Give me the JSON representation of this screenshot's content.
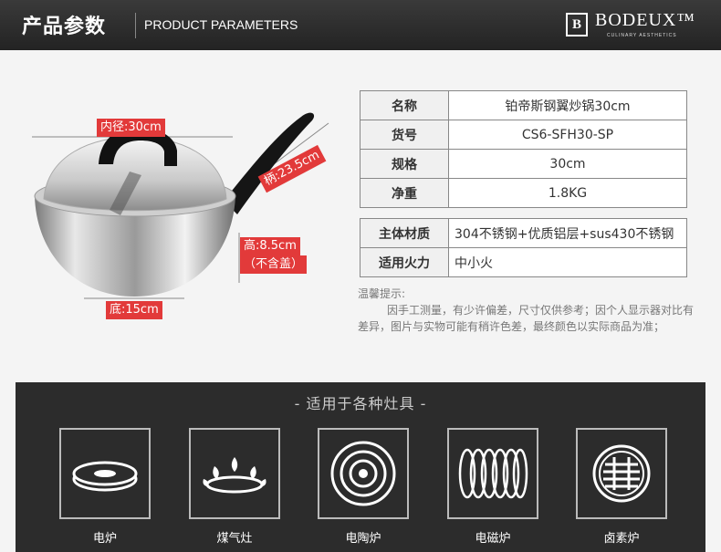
{
  "header": {
    "title_cn": "产品参数",
    "title_en": "PRODUCT PARAMETERS",
    "brand": "BODEUX™",
    "brand_sub": "CULINARY AESTHETICS",
    "logo_mark": "B"
  },
  "product": {
    "image_icon": "wok-with-glass-lid",
    "dimensions": {
      "inner_diameter": "内径:30cm",
      "handle": "柄:23.5cm",
      "height": "高:8.5cm",
      "height_note": "（不含盖）",
      "base": "底:15cm"
    }
  },
  "specs": [
    {
      "key": "名称",
      "value": "铂帝斯钢翼炒锅30cm"
    },
    {
      "key": "货号",
      "value": "CS6-SFH30-SP"
    },
    {
      "key": "规格",
      "value": "30cm"
    },
    {
      "key": "净重",
      "value": "1.8KG"
    }
  ],
  "specs2": [
    {
      "key": "主体材质",
      "value": "304不锈钢+优质铝层+sus430不锈钢"
    },
    {
      "key": "适用火力",
      "value": "中小火"
    }
  ],
  "tips": {
    "title": "温馨提示:",
    "body": "因手工测量，有少许偏差，尺寸仅供参考；因个人显示器对比有差异，图片与实物可能有稍许色差，最终颜色以实际商品为准；"
  },
  "stoves": {
    "title": "- 适用于各种灶具 -",
    "items": [
      {
        "label": "电炉",
        "icon": "electric-hotplate-icon"
      },
      {
        "label": "煤气灶",
        "icon": "gas-burner-icon"
      },
      {
        "label": "电陶炉",
        "icon": "ceramic-cooktop-icon"
      },
      {
        "label": "电磁炉",
        "icon": "induction-coil-icon"
      },
      {
        "label": "卤素炉",
        "icon": "halogen-cooktop-icon"
      }
    ]
  },
  "colors": {
    "header_bg": "#2a2a2a",
    "label_red": "#e23a3a",
    "stove_bg": "#2c2c2c"
  }
}
